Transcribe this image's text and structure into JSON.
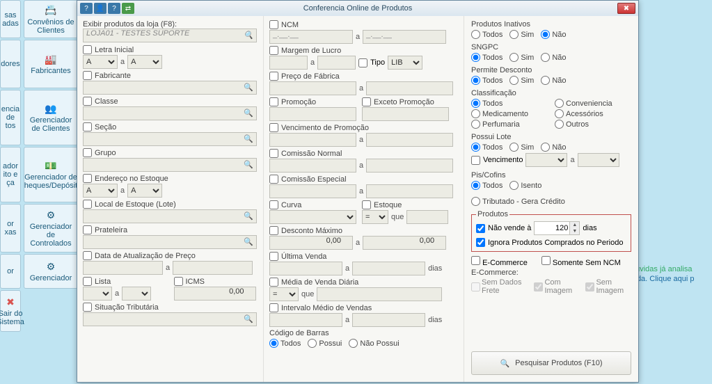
{
  "window": {
    "title": "Conferencia Online de Produtos"
  },
  "ribbon": {
    "col1": [
      "sas\nadas",
      "dores",
      "encia\nde\ntos",
      "ador\nito e\nça",
      "or\nxas",
      "or"
    ],
    "col2": [
      "Convênios de\nClientes",
      "Fabricantes",
      "Gerenciador\nde Clientes",
      "Gerenciador de\nheques/Depósit",
      "Gerenciador\nde\nControlados",
      "Gerenciador"
    ],
    "exit": "Sair do\nSistema"
  },
  "col1": {
    "store_label": "Exibir produtos da loja (F8):",
    "store_value": "LOJA01 - TESTES SUPORTE",
    "letra": "Letra Inicial",
    "fabricante": "Fabricante",
    "classe": "Classe",
    "secao": "Seção",
    "grupo": "Grupo",
    "endereco": "Endereço no Estoque",
    "local": "Local de Estoque (Lote)",
    "prateleira": "Prateleira",
    "data_atual": "Data de Atualização de Preço",
    "lista": "Lista",
    "icms": "ICMS",
    "icms_value": "0,00",
    "situacao": "Situação Tributária",
    "a": "a",
    "val_a": "A",
    "dd_a": "A"
  },
  "col2": {
    "ncm": "NCM",
    "ncm_mask": "_.__.__",
    "margem": "Margem de Lucro",
    "tipo": "Tipo",
    "tipo_val": "LIB",
    "preco": "Preço de Fábrica",
    "promocao": "Promoção",
    "exceto": "Exceto Promoção",
    "venc_promo": "Vencimento de Promoção",
    "com_normal": "Comissão Normal",
    "com_esp": "Comissão Especial",
    "curva": "Curva",
    "estoque": "Estoque",
    "que": "que",
    "desc_max": "Desconto Máximo",
    "zero": "0,00",
    "ultima": "Última Venda",
    "dias": "dias",
    "media_diaria": "Média de Venda Diária",
    "intervalo": "Intervalo Médio de Vendas",
    "cod_barras": "Código de Barras",
    "cb_todos": "Todos",
    "cb_possui": "Possui",
    "cb_nao": "Não Possui",
    "a": "a",
    "eq": "="
  },
  "col3": {
    "inativos": "Produtos Inativos",
    "todos": "Todos",
    "sim": "Sim",
    "nao": "Não",
    "sngpc": "SNGPC",
    "desconto": "Permite Desconto",
    "classif": "Classificação",
    "conv": "Conveniencia",
    "med": "Medicamento",
    "acess": "Acessórios",
    "perf": "Perfumaria",
    "outros": "Outros",
    "lote": "Possui Lote",
    "venc": "Vencimento",
    "piscofins": "Pis/Cofins",
    "isento": "Isento",
    "tributado": "Tributado - Gera Crédito",
    "produtos": "Produtos",
    "nao_vende": "Não vende à",
    "nao_vende_val": "120",
    "dias": "dias",
    "ignora": "Ignora Produtos Comprados no Periodo",
    "ecommerce": "E-Commerce",
    "somente_ncm": "Somente Sem NCM",
    "ecomm_lbl": "E-Commerce:",
    "sem_frete": "Sem Dados Frete",
    "com_img": "Com Imagem",
    "sem_img": "Sem Imagem",
    "pesquisar": "Pesquisar Produtos (F10)",
    "a": "a"
  },
  "bg": {
    "line1": "dúvidas já analisa",
    "line2": "vida. Clique aqui p"
  }
}
